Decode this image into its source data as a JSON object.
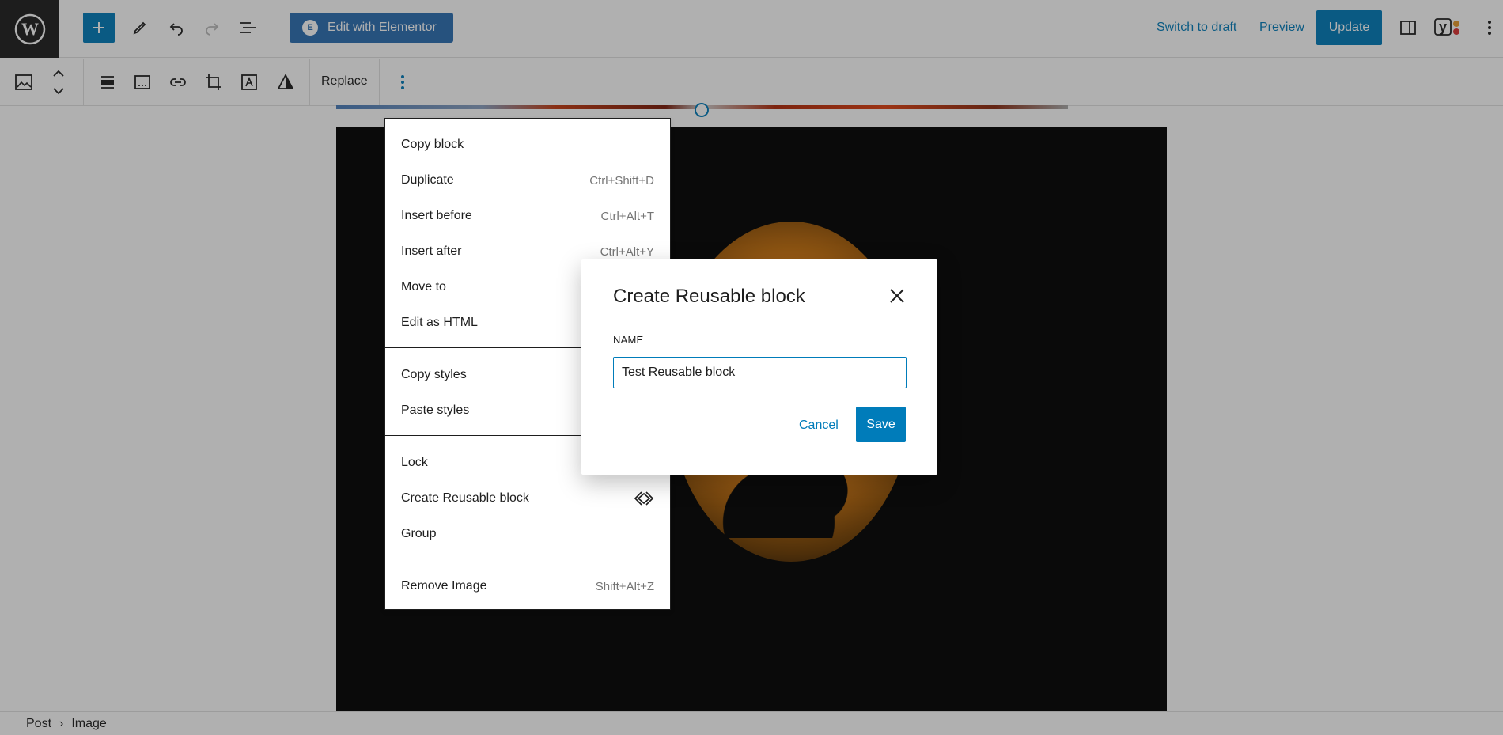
{
  "header": {
    "wordpress_logo": "W",
    "add_block_icon": "plus-icon",
    "edit_with_elementor": "Edit with Elementor",
    "elementor_badge": "E",
    "switch_to_draft": "Switch to draft",
    "preview": "Preview",
    "update": "Update",
    "yoast_icon": "y"
  },
  "block_toolbar": {
    "replace": "Replace"
  },
  "block_menu": {
    "group1": [
      {
        "label": "Copy block",
        "shortcut": ""
      },
      {
        "label": "Duplicate",
        "shortcut": "Ctrl+Shift+D"
      },
      {
        "label": "Insert before",
        "shortcut": "Ctrl+Alt+T"
      },
      {
        "label": "Insert after",
        "shortcut": "Ctrl+Alt+Y"
      },
      {
        "label": "Move to",
        "shortcut": ""
      },
      {
        "label": "Edit as HTML",
        "shortcut": ""
      }
    ],
    "group2": [
      {
        "label": "Copy styles"
      },
      {
        "label": "Paste styles"
      }
    ],
    "group3": [
      {
        "label": "Lock"
      },
      {
        "label": "Create Reusable block"
      },
      {
        "label": "Group"
      }
    ],
    "group4": [
      {
        "label": "Remove Image",
        "shortcut": "Shift+Alt+Z"
      }
    ]
  },
  "modal": {
    "title": "Create Reusable block",
    "name_label": "NAME",
    "name_value": "Test Reusable block",
    "cancel": "Cancel",
    "save": "Save"
  },
  "breadcrumb": {
    "root": "Post",
    "separator": "›",
    "current": "Image"
  },
  "colors": {
    "accent": "#007cba",
    "elementor": "#2c6fb2",
    "logo_bg": "#1e1e1e"
  }
}
